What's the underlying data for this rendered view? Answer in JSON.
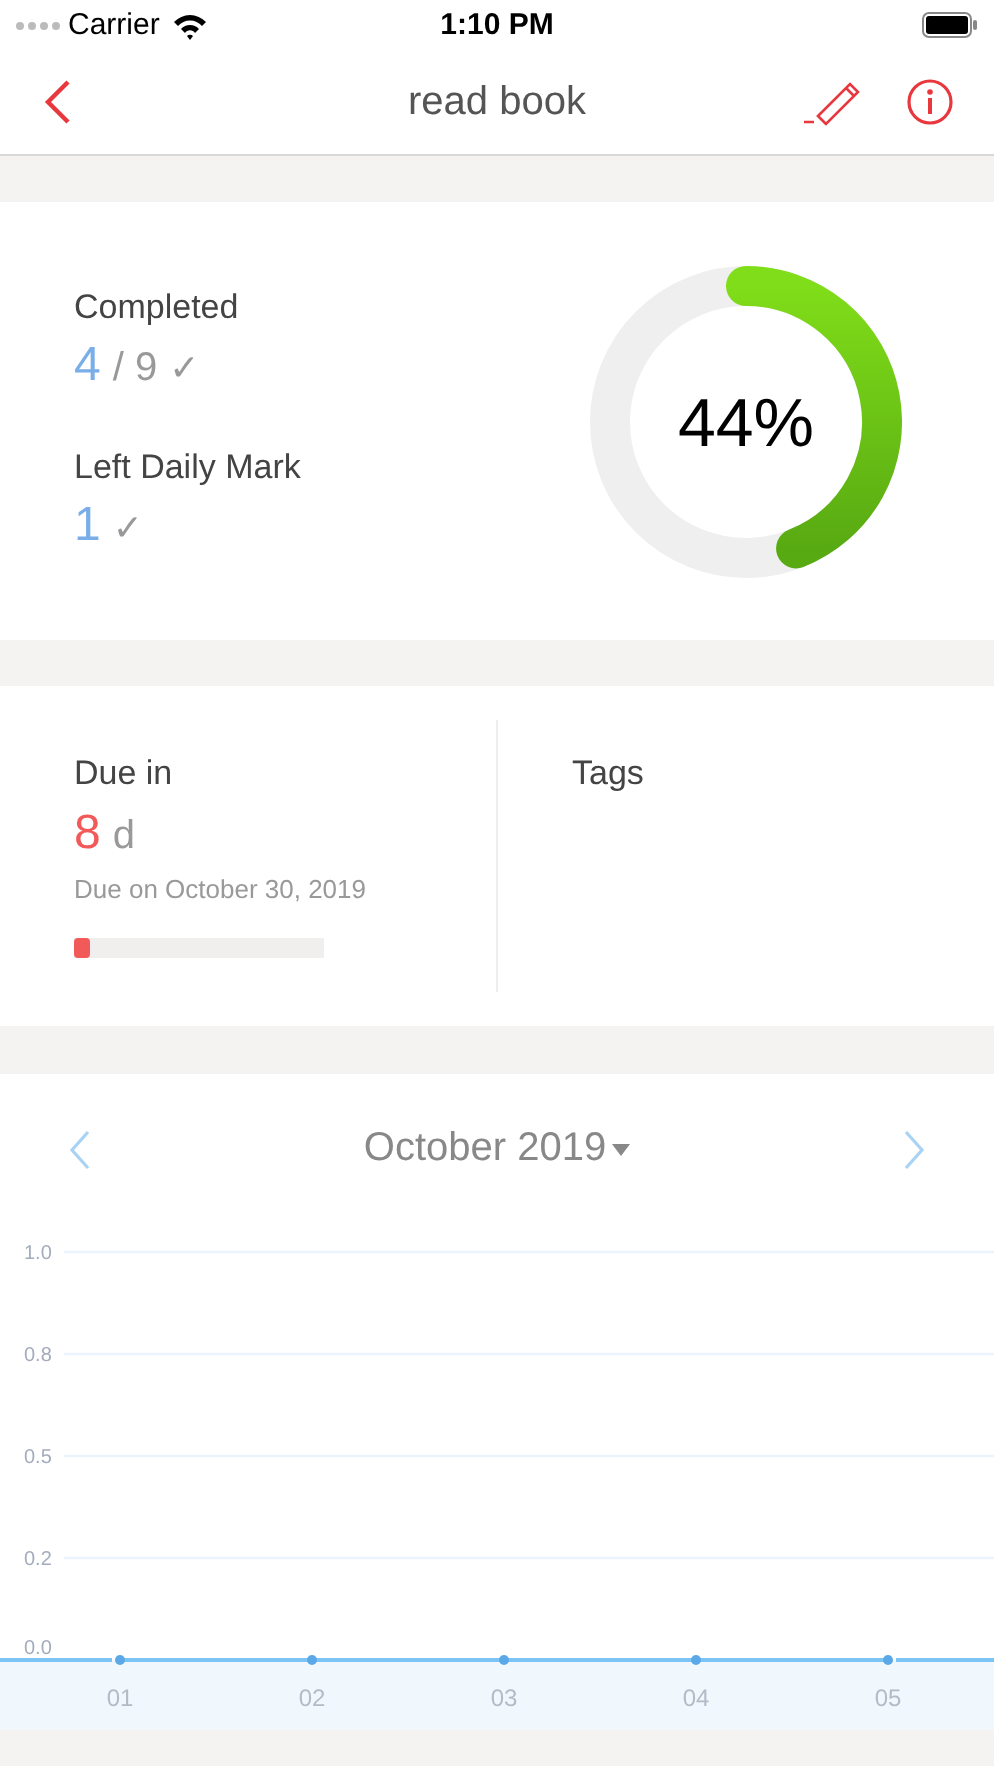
{
  "status_bar": {
    "carrier": "Carrier",
    "time": "1:10 PM"
  },
  "nav": {
    "title": "read book"
  },
  "completed": {
    "label": "Completed",
    "done": "4",
    "total": "/ 9",
    "check": "✓"
  },
  "left_daily": {
    "label": "Left Daily Mark",
    "value": "1",
    "check": "✓"
  },
  "ring": {
    "percent": "44%"
  },
  "due": {
    "label": "Due in",
    "days": "8",
    "unit": "d",
    "date": "Due on October 30, 2019",
    "level": 0.06
  },
  "tags": {
    "label": "Tags"
  },
  "calendar": {
    "month": "October 2019",
    "chart_data": {
      "type": "line",
      "categories": [
        "01",
        "02",
        "03",
        "04",
        "05"
      ],
      "series": [
        {
          "color": "#7cc4f5",
          "marker": true,
          "values": [
            0,
            0,
            0,
            0,
            0
          ]
        }
      ],
      "grid": true,
      "ylim": [
        0,
        1
      ],
      "yticks": [
        {
          "value": 0,
          "label": "0.0"
        },
        {
          "value": 0.25,
          "label": "0.2"
        },
        {
          "value": 0.5,
          "label": "0.5"
        },
        {
          "value": 0.75,
          "label": "0.8"
        },
        {
          "value": 1,
          "label": "1.0"
        }
      ]
    }
  }
}
